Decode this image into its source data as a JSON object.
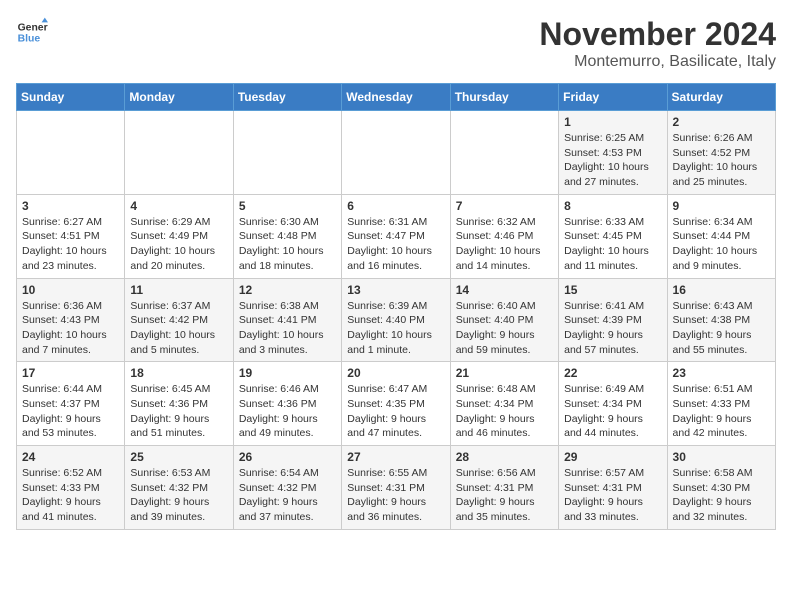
{
  "logo": {
    "line1": "General",
    "line2": "Blue"
  },
  "title": "November 2024",
  "location": "Montemurro, Basilicate, Italy",
  "days_of_week": [
    "Sunday",
    "Monday",
    "Tuesday",
    "Wednesday",
    "Thursday",
    "Friday",
    "Saturday"
  ],
  "weeks": [
    [
      {
        "day": "",
        "detail": ""
      },
      {
        "day": "",
        "detail": ""
      },
      {
        "day": "",
        "detail": ""
      },
      {
        "day": "",
        "detail": ""
      },
      {
        "day": "",
        "detail": ""
      },
      {
        "day": "1",
        "detail": "Sunrise: 6:25 AM\nSunset: 4:53 PM\nDaylight: 10 hours and 27 minutes."
      },
      {
        "day": "2",
        "detail": "Sunrise: 6:26 AM\nSunset: 4:52 PM\nDaylight: 10 hours and 25 minutes."
      }
    ],
    [
      {
        "day": "3",
        "detail": "Sunrise: 6:27 AM\nSunset: 4:51 PM\nDaylight: 10 hours and 23 minutes."
      },
      {
        "day": "4",
        "detail": "Sunrise: 6:29 AM\nSunset: 4:49 PM\nDaylight: 10 hours and 20 minutes."
      },
      {
        "day": "5",
        "detail": "Sunrise: 6:30 AM\nSunset: 4:48 PM\nDaylight: 10 hours and 18 minutes."
      },
      {
        "day": "6",
        "detail": "Sunrise: 6:31 AM\nSunset: 4:47 PM\nDaylight: 10 hours and 16 minutes."
      },
      {
        "day": "7",
        "detail": "Sunrise: 6:32 AM\nSunset: 4:46 PM\nDaylight: 10 hours and 14 minutes."
      },
      {
        "day": "8",
        "detail": "Sunrise: 6:33 AM\nSunset: 4:45 PM\nDaylight: 10 hours and 11 minutes."
      },
      {
        "day": "9",
        "detail": "Sunrise: 6:34 AM\nSunset: 4:44 PM\nDaylight: 10 hours and 9 minutes."
      }
    ],
    [
      {
        "day": "10",
        "detail": "Sunrise: 6:36 AM\nSunset: 4:43 PM\nDaylight: 10 hours and 7 minutes."
      },
      {
        "day": "11",
        "detail": "Sunrise: 6:37 AM\nSunset: 4:42 PM\nDaylight: 10 hours and 5 minutes."
      },
      {
        "day": "12",
        "detail": "Sunrise: 6:38 AM\nSunset: 4:41 PM\nDaylight: 10 hours and 3 minutes."
      },
      {
        "day": "13",
        "detail": "Sunrise: 6:39 AM\nSunset: 4:40 PM\nDaylight: 10 hours and 1 minute."
      },
      {
        "day": "14",
        "detail": "Sunrise: 6:40 AM\nSunset: 4:40 PM\nDaylight: 9 hours and 59 minutes."
      },
      {
        "day": "15",
        "detail": "Sunrise: 6:41 AM\nSunset: 4:39 PM\nDaylight: 9 hours and 57 minutes."
      },
      {
        "day": "16",
        "detail": "Sunrise: 6:43 AM\nSunset: 4:38 PM\nDaylight: 9 hours and 55 minutes."
      }
    ],
    [
      {
        "day": "17",
        "detail": "Sunrise: 6:44 AM\nSunset: 4:37 PM\nDaylight: 9 hours and 53 minutes."
      },
      {
        "day": "18",
        "detail": "Sunrise: 6:45 AM\nSunset: 4:36 PM\nDaylight: 9 hours and 51 minutes."
      },
      {
        "day": "19",
        "detail": "Sunrise: 6:46 AM\nSunset: 4:36 PM\nDaylight: 9 hours and 49 minutes."
      },
      {
        "day": "20",
        "detail": "Sunrise: 6:47 AM\nSunset: 4:35 PM\nDaylight: 9 hours and 47 minutes."
      },
      {
        "day": "21",
        "detail": "Sunrise: 6:48 AM\nSunset: 4:34 PM\nDaylight: 9 hours and 46 minutes."
      },
      {
        "day": "22",
        "detail": "Sunrise: 6:49 AM\nSunset: 4:34 PM\nDaylight: 9 hours and 44 minutes."
      },
      {
        "day": "23",
        "detail": "Sunrise: 6:51 AM\nSunset: 4:33 PM\nDaylight: 9 hours and 42 minutes."
      }
    ],
    [
      {
        "day": "24",
        "detail": "Sunrise: 6:52 AM\nSunset: 4:33 PM\nDaylight: 9 hours and 41 minutes."
      },
      {
        "day": "25",
        "detail": "Sunrise: 6:53 AM\nSunset: 4:32 PM\nDaylight: 9 hours and 39 minutes."
      },
      {
        "day": "26",
        "detail": "Sunrise: 6:54 AM\nSunset: 4:32 PM\nDaylight: 9 hours and 37 minutes."
      },
      {
        "day": "27",
        "detail": "Sunrise: 6:55 AM\nSunset: 4:31 PM\nDaylight: 9 hours and 36 minutes."
      },
      {
        "day": "28",
        "detail": "Sunrise: 6:56 AM\nSunset: 4:31 PM\nDaylight: 9 hours and 35 minutes."
      },
      {
        "day": "29",
        "detail": "Sunrise: 6:57 AM\nSunset: 4:31 PM\nDaylight: 9 hours and 33 minutes."
      },
      {
        "day": "30",
        "detail": "Sunrise: 6:58 AM\nSunset: 4:30 PM\nDaylight: 9 hours and 32 minutes."
      }
    ]
  ]
}
